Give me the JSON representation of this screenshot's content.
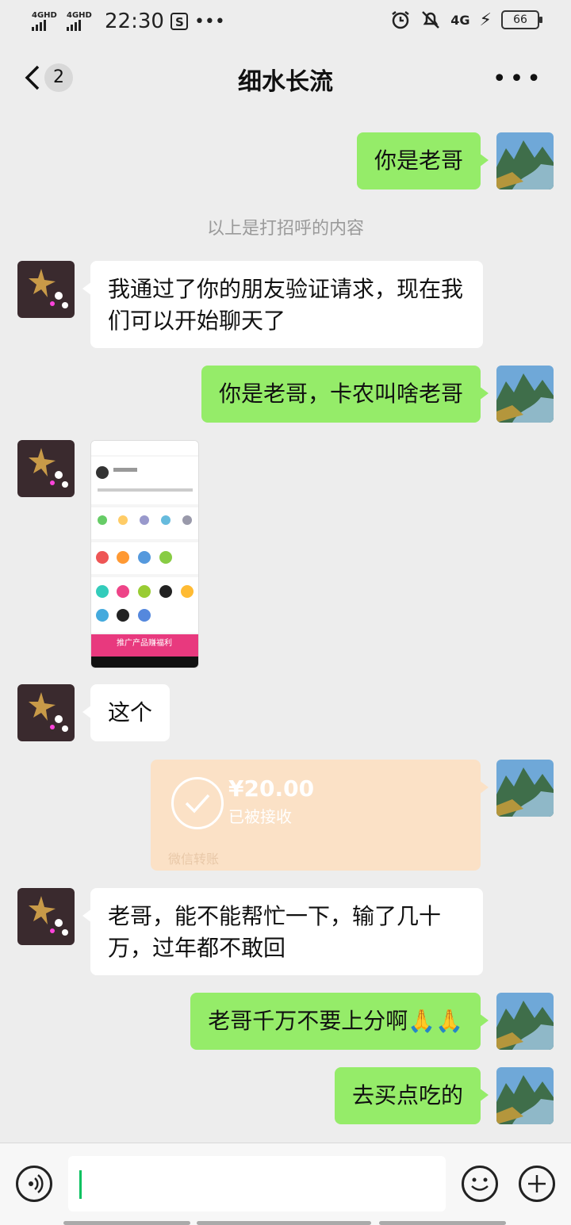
{
  "status_bar": {
    "network_1": "4GHD",
    "network_2": "4GHD",
    "time": "22:30",
    "right_network": "4G",
    "battery": "66"
  },
  "header": {
    "unread_count": "2",
    "title": "细水长流"
  },
  "messages": {
    "m1": "你是老哥",
    "system_note": "以上是打招呼的内容",
    "m2": "我通过了你的朋友验证请求，现在我们可以开始聊天了",
    "m3": "你是老哥，卡农叫啥老哥",
    "m5": "这个",
    "m7": "老哥，能不能帮忙一下，输了几十万，过年都不敢回",
    "m8": "老哥千万不要上分啊🙏🙏",
    "m9": "去买点吃的"
  },
  "transfer": {
    "amount": "¥20.00",
    "status": "已被接收",
    "footer": "微信转账"
  },
  "screenshot": {
    "banner_text": "推广产品赚福利"
  },
  "colors": {
    "sent_bubble": "#95ec69",
    "received_bubble": "#ffffff",
    "transfer_bubble": "#fbe1c6",
    "background": "#ededed"
  }
}
